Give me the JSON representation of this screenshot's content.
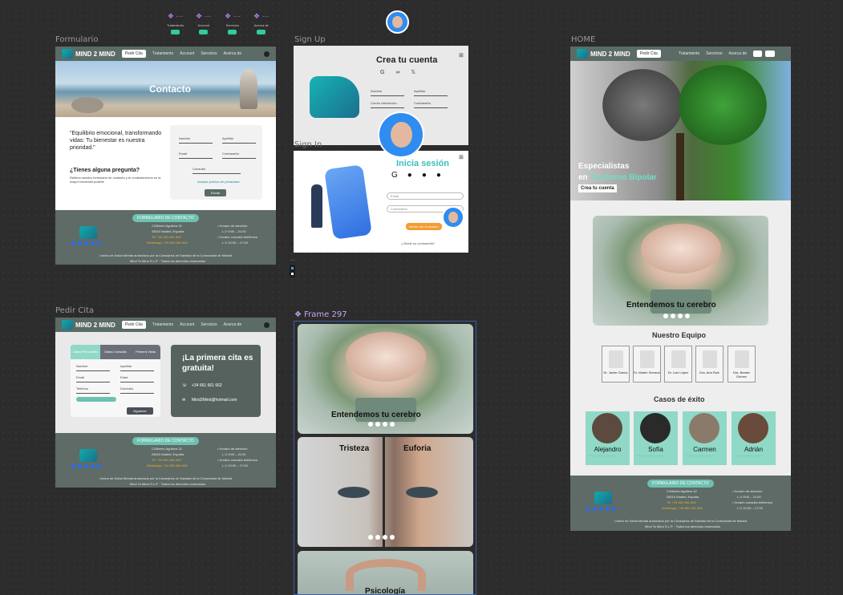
{
  "frames": {
    "formulario": "Formulario",
    "signup": "Sign Up",
    "signin": "Sign In",
    "home": "HOME",
    "pedir": "Pedir Cita",
    "frame297": "Frame 297"
  },
  "top_components": [
    {
      "label": "Tratamiento"
    },
    {
      "label": "Account"
    },
    {
      "label": "Servicios"
    },
    {
      "label": "Acerca de"
    }
  ],
  "nav": {
    "brand": "MIND 2 MIND",
    "cta": "Pedir Cita",
    "links": [
      "Tratamiento",
      "Account",
      "Servicios",
      "Acerca de"
    ]
  },
  "contacto": {
    "hero": "Contacto",
    "quote": "\"Equilibrio emocional, transformando vidas: Tu bienestar es nuestra prioridad.\"",
    "q_title": "¿Tienes alguna pregunta?",
    "q_sub": "Rellena nuestro formulario de contacto y te contestaremos en la mayor brevedad posible",
    "fields": [
      "Nombre",
      "Apellido",
      "Email",
      "Contraseña",
      "Consulta"
    ],
    "accept": "Aceptar política de privacidad",
    "send": "Enviar"
  },
  "footer": {
    "pill": "FORMULARIO DE CONTACTO",
    "addr1": "C/Alberto Aguilera 32",
    "addr2": "28015 Madrid, España",
    "tel": "Tlf: +34 661 661 662",
    "wa": "WhatsApp: +34 661 661 662",
    "h1": "• Horario de atención",
    "h1v": "L-V 9:00 – 21:00",
    "h2": "• Horario consulta telefónica",
    "h2v": "L-V 10:00 – 17:00",
    "legal1": "Centro de Salud Mental autorizado por la Consejería de Sanidad de la Comunidad de Madrid",
    "legal2": "Mind To Mind S.L.P. · Todos los derechos reservados"
  },
  "signup": {
    "title": "Crea tu cuenta",
    "fields": [
      "Nombre",
      "Apellido",
      "Correo electrónico",
      "Contraseña"
    ]
  },
  "signin": {
    "title": "Inicia sesión",
    "fields": [
      "Email",
      "Contraseña"
    ],
    "submit": "Iniciar con el usuario",
    "forgot": "¿Olvidó su contraseña?"
  },
  "pedir": {
    "tabs": [
      "Datos Personales",
      "Datos Consulta",
      "Primera Visita"
    ],
    "fields": [
      "Nombre",
      "Apellido",
      "Email",
      "Edad",
      "Teléfono",
      "Domicilio"
    ],
    "send": "Siguiente",
    "promo": "¡La primera cita es gratuita!",
    "phone": "+34 661 661 662",
    "email": "Mind2Mind@hotmail.com"
  },
  "home": {
    "brand": "MIND 2 MIND",
    "cta": "Pedir Cita",
    "links": [
      "Tratamiento",
      "Servicios",
      "Acerca de"
    ],
    "hero1": "Especialistas",
    "hero2a": "en ",
    "hero2b": "Trastorno Bipolar",
    "hero_btn": "Crea tu cuenta",
    "slide": "Entendemos tu cerebro",
    "team_title": "Nuestro Equipo",
    "team": [
      "Dr. Javier García",
      "Dr. Martín Serrano",
      "Dr. Luis López",
      "Dra. Ana Ruiz",
      "Dra. Beatriz Gómez"
    ],
    "cases_title": "Casos de éxito",
    "cases": [
      "Alejandro",
      "Sofía",
      "Carmen",
      "Adrián"
    ]
  },
  "frame297": {
    "s1": "Entendemos tu cerebro",
    "s2a": "Tristeza",
    "s2b": "Euforia",
    "s3": "Psicología"
  }
}
